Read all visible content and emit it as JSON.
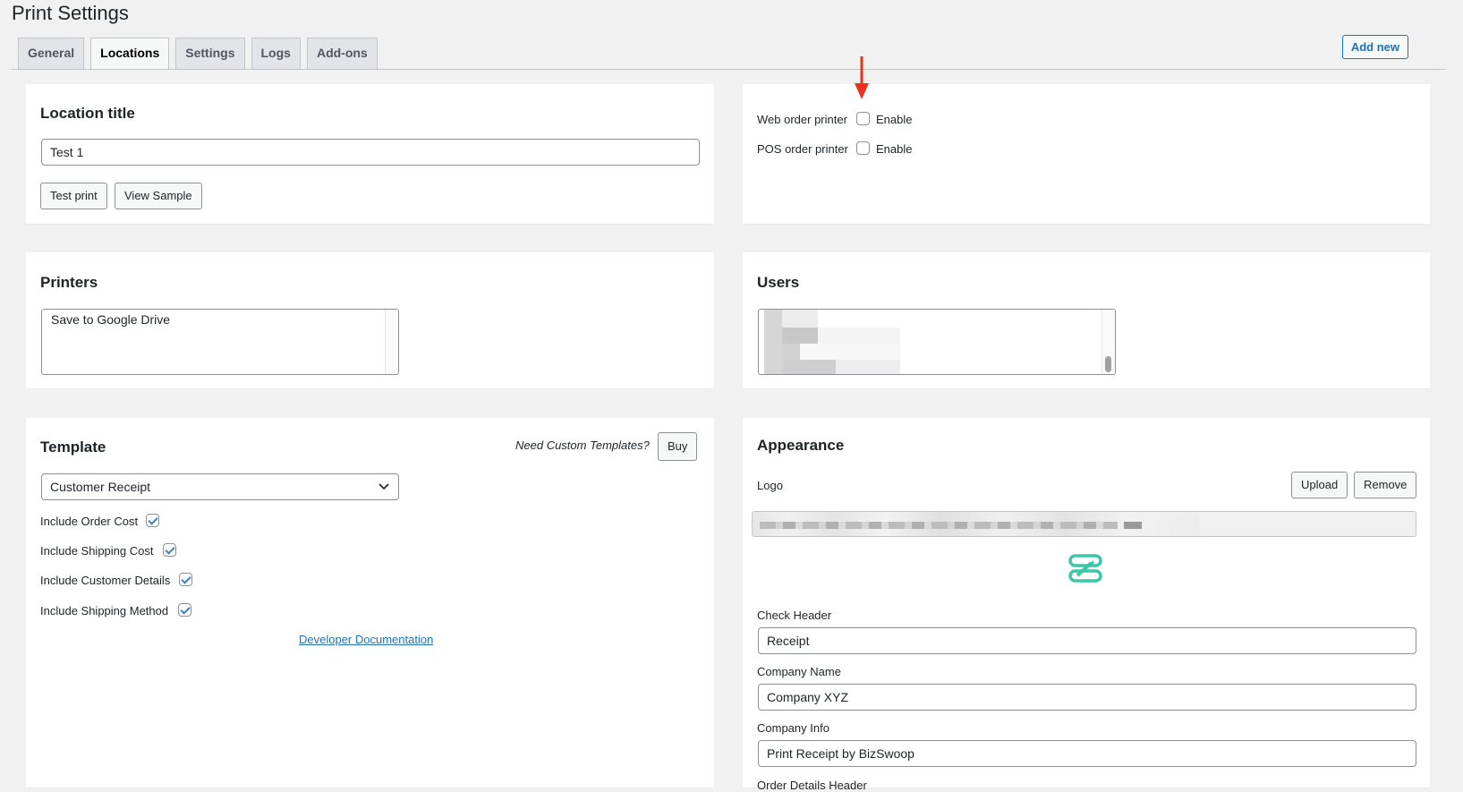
{
  "page": {
    "title": "Print Settings"
  },
  "tabs": [
    "General",
    "Locations",
    "Settings",
    "Logs",
    "Add-ons"
  ],
  "header": {
    "add_new_label": "Add new"
  },
  "location_card": {
    "heading": "Location title",
    "title_value": "Test 1",
    "test_print_label": "Test print",
    "view_sample_label": "View Sample"
  },
  "order_printers": {
    "web_label": "Web order printer",
    "web_enable_label": "Enable",
    "web_enabled": false,
    "pos_label": "POS order printer",
    "pos_enable_label": "Enable",
    "pos_enabled": false
  },
  "printers_card": {
    "heading": "Printers",
    "items": [
      "Save to Google Drive"
    ]
  },
  "users_card": {
    "heading": "Users"
  },
  "template_card": {
    "heading": "Template",
    "custom_prompt": "Need Custom Templates?",
    "buy_label": "Buy",
    "selected_template": "Customer Receipt",
    "options": [
      {
        "label": "Include Order Cost",
        "checked": true
      },
      {
        "label": "Include Shipping Cost",
        "checked": true
      },
      {
        "label": "Include Customer Details",
        "checked": true
      },
      {
        "label": "Include Shipping Method",
        "checked": true
      }
    ],
    "doc_link": "Developer Documentation"
  },
  "appearance_card": {
    "heading": "Appearance",
    "logo_label": "Logo",
    "upload_label": "Upload",
    "remove_label": "Remove",
    "check_header_label": "Check Header",
    "check_header_value": "Receipt",
    "company_name_label": "Company Name",
    "company_name_value": "Company XYZ",
    "company_info_label": "Company Info",
    "company_info_value": "Print Receipt by BizSwoop",
    "order_details_label": "Order Details Header"
  },
  "colors": {
    "accent": "#2271b1",
    "arrow": "#e8321b",
    "logo_mark": "#3cc6a8"
  }
}
